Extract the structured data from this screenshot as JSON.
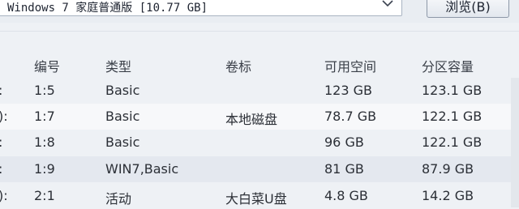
{
  "os_select": {
    "value": "Windows 7 家庭普通版 [10.77 GB]"
  },
  "browse_button": {
    "label": "浏览(B)"
  },
  "table": {
    "headers": [
      "编号",
      "类型",
      "卷标",
      "可用空间",
      "分区容量"
    ],
    "rows": [
      {
        "marker": ":",
        "id": "1:5",
        "type": "Basic",
        "label": "",
        "free": "123 GB",
        "size": "123.1 GB"
      },
      {
        "marker": "):",
        "id": "1:7",
        "type": "Basic",
        "label": "本地磁盘",
        "free": "78.7 GB",
        "size": "122.1 GB"
      },
      {
        "marker": ":",
        "id": "1:8",
        "type": "Basic",
        "label": "",
        "free": "96 GB",
        "size": "122.1 GB"
      },
      {
        "marker": ":",
        "id": "1:9",
        "type": "WIN7,Basic",
        "label": "",
        "free": "81 GB",
        "size": "87.9 GB"
      },
      {
        "marker": "):",
        "id": "2:1",
        "type": "活动",
        "label": "大白菜U盘",
        "free": "4.8 GB",
        "size": "14.2 GB"
      }
    ]
  }
}
